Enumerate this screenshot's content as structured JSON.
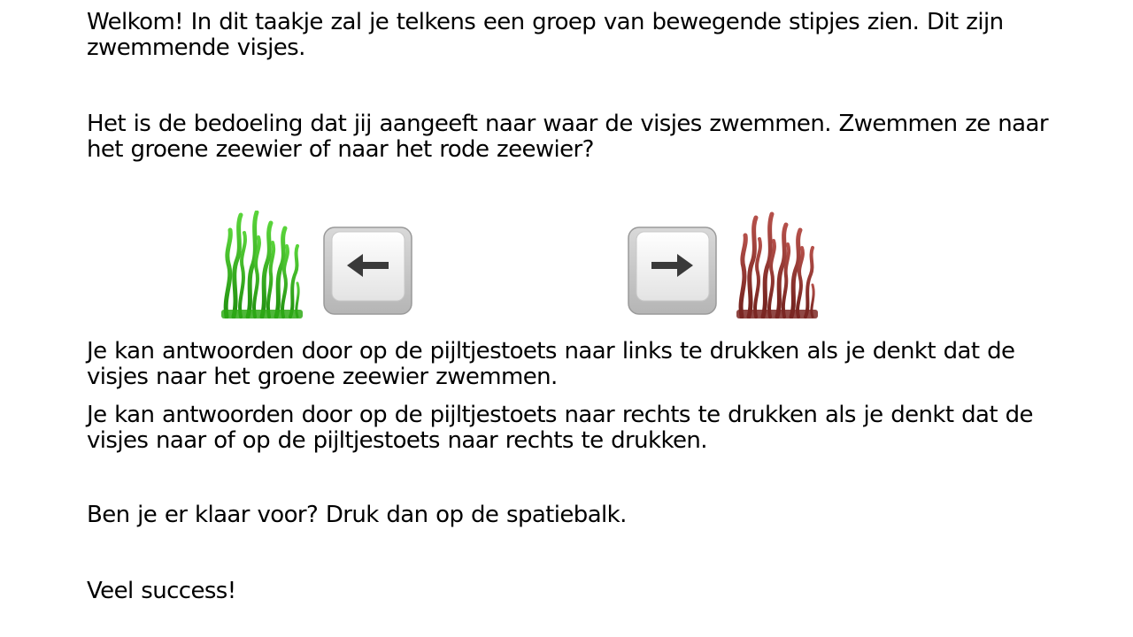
{
  "instructions": {
    "welcome": "Welkom! In dit taakje zal je telkens een groep van bewegende stipjes zien. Dit zijn zwemmende visjes.",
    "goal": "Het is de bedoeling dat jij aangeeft naar waar de visjes zwemmen. Zwemmen ze naar het groene zeewier of naar het rode zeewier?",
    "left_answer": "Je kan antwoorden door op de pijltjestoets naar links te drukken als je denkt dat de visjes naar het groene zeewier zwemmen.",
    "right_answer": "Je kan antwoorden door op de pijltjestoets naar rechts te drukken als je denkt dat de visjes naar of op de pijltjestoets naar rechts te drukken.",
    "ready": "Ben je er klaar voor? Druk dan op de spatiebalk.",
    "luck": "Veel success!"
  },
  "icons": {
    "left_seaweed": "green-seaweed-icon",
    "left_key": "left-arrow-key-icon",
    "right_key": "right-arrow-key-icon",
    "right_seaweed": "red-seaweed-icon"
  },
  "colors": {
    "green_seaweed": "#3fbf1c",
    "red_seaweed": "#8e2f2a",
    "key_face": "#ececec",
    "arrow": "#3a3a3a"
  }
}
